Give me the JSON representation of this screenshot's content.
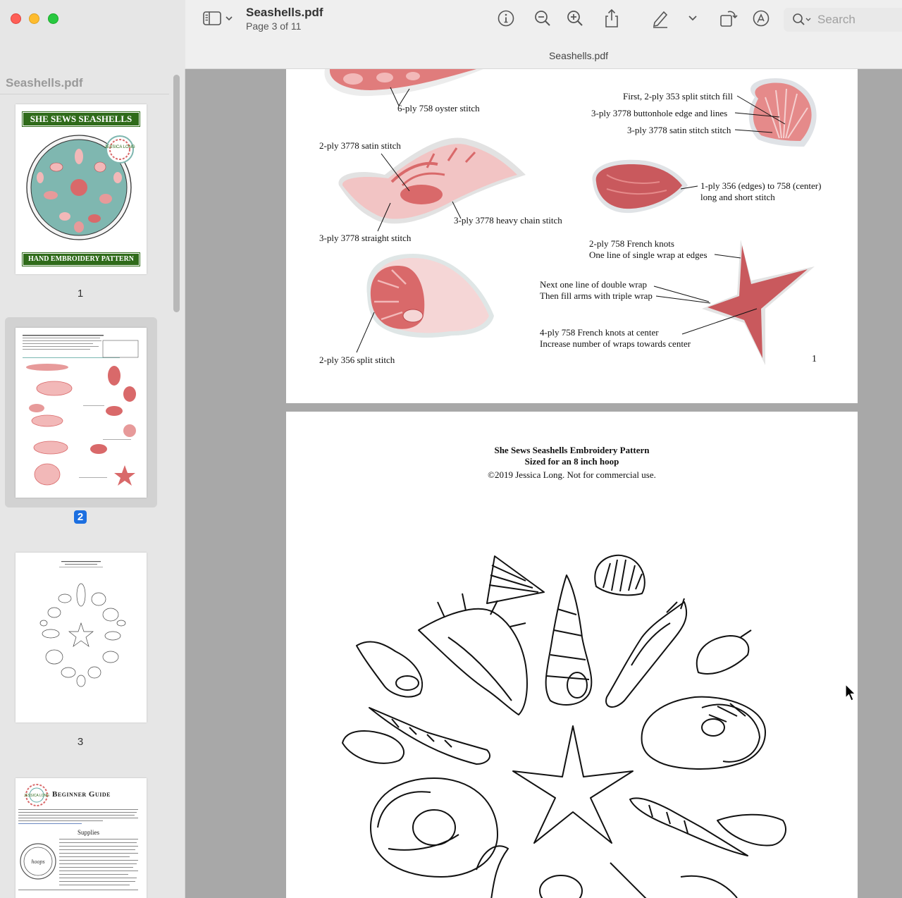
{
  "window": {
    "doc_title": "Seashells.pdf",
    "page_info": "Page 3 of 11",
    "center_title": "Seashells.pdf"
  },
  "toolbar": {
    "search_placeholder": "Search",
    "icons": [
      "sidebar-toggle-icon",
      "chevron-down-icon",
      "info-icon",
      "zoom-out-icon",
      "zoom-in-icon",
      "share-icon",
      "markup-pen-icon",
      "rotate-icon",
      "annotate-icon",
      "search-icon"
    ]
  },
  "sidebar": {
    "header": "Seashells.pdf",
    "thumbnails": [
      {
        "number": "1",
        "banner_top": "SHE SEWS SEASHELLS",
        "banner_bottom": "HAND EMBROIDERY PATTERN",
        "badge": "JESSICA LONG"
      },
      {
        "number": "2"
      },
      {
        "number": "3"
      },
      {
        "title": "Beginner Guide",
        "subheading": "Supplies",
        "badge": "JESSICA LONG",
        "hoop_label": "hoops"
      }
    ],
    "selected_index": 1
  },
  "page2": {
    "labels": {
      "oyster": "6-ply 758 oyster stitch",
      "first_split": "First, 2-ply 353 split stitch fill",
      "buttonhole": "3-ply 3778 buttonhole edge and lines",
      "satin_scallop": "3-ply 3778 satin stitch stitch",
      "satin_conch": "2-ply 3778 satin stitch",
      "heavy_chain": "3-ply 3778 heavy chain stitch",
      "straight": "3-ply 3778 straight stitch",
      "long_short_1": "1-ply 356 (edges) to 758 (center)",
      "long_short_2": "long and short stitch",
      "french_1": "2-ply 758 French knots",
      "french_2": "One line of single wrap at edges",
      "double_wrap_1": "Next one line of double wrap",
      "double_wrap_2": "Then fill arms with triple wrap",
      "center_1": "4-ply 758 French knots at center",
      "center_2": "Increase number of wraps towards center",
      "split_356": "2-ply 356 split stitch"
    },
    "page_number": "1"
  },
  "page3": {
    "title": "She Sews Seashells Embroidery Pattern",
    "subtitle": "Sized for an 8 inch hoop",
    "copyright": "©2019 Jessica Long. Not for commercial use."
  },
  "colors": {
    "shell_pink": "#f2b8b8",
    "shell_coral": "#d9696a",
    "shell_dark": "#b9474b",
    "hoop_teal": "#7fb7b0",
    "banner_green": "#2f6b1a",
    "selection_blue": "#1c6fe0"
  }
}
